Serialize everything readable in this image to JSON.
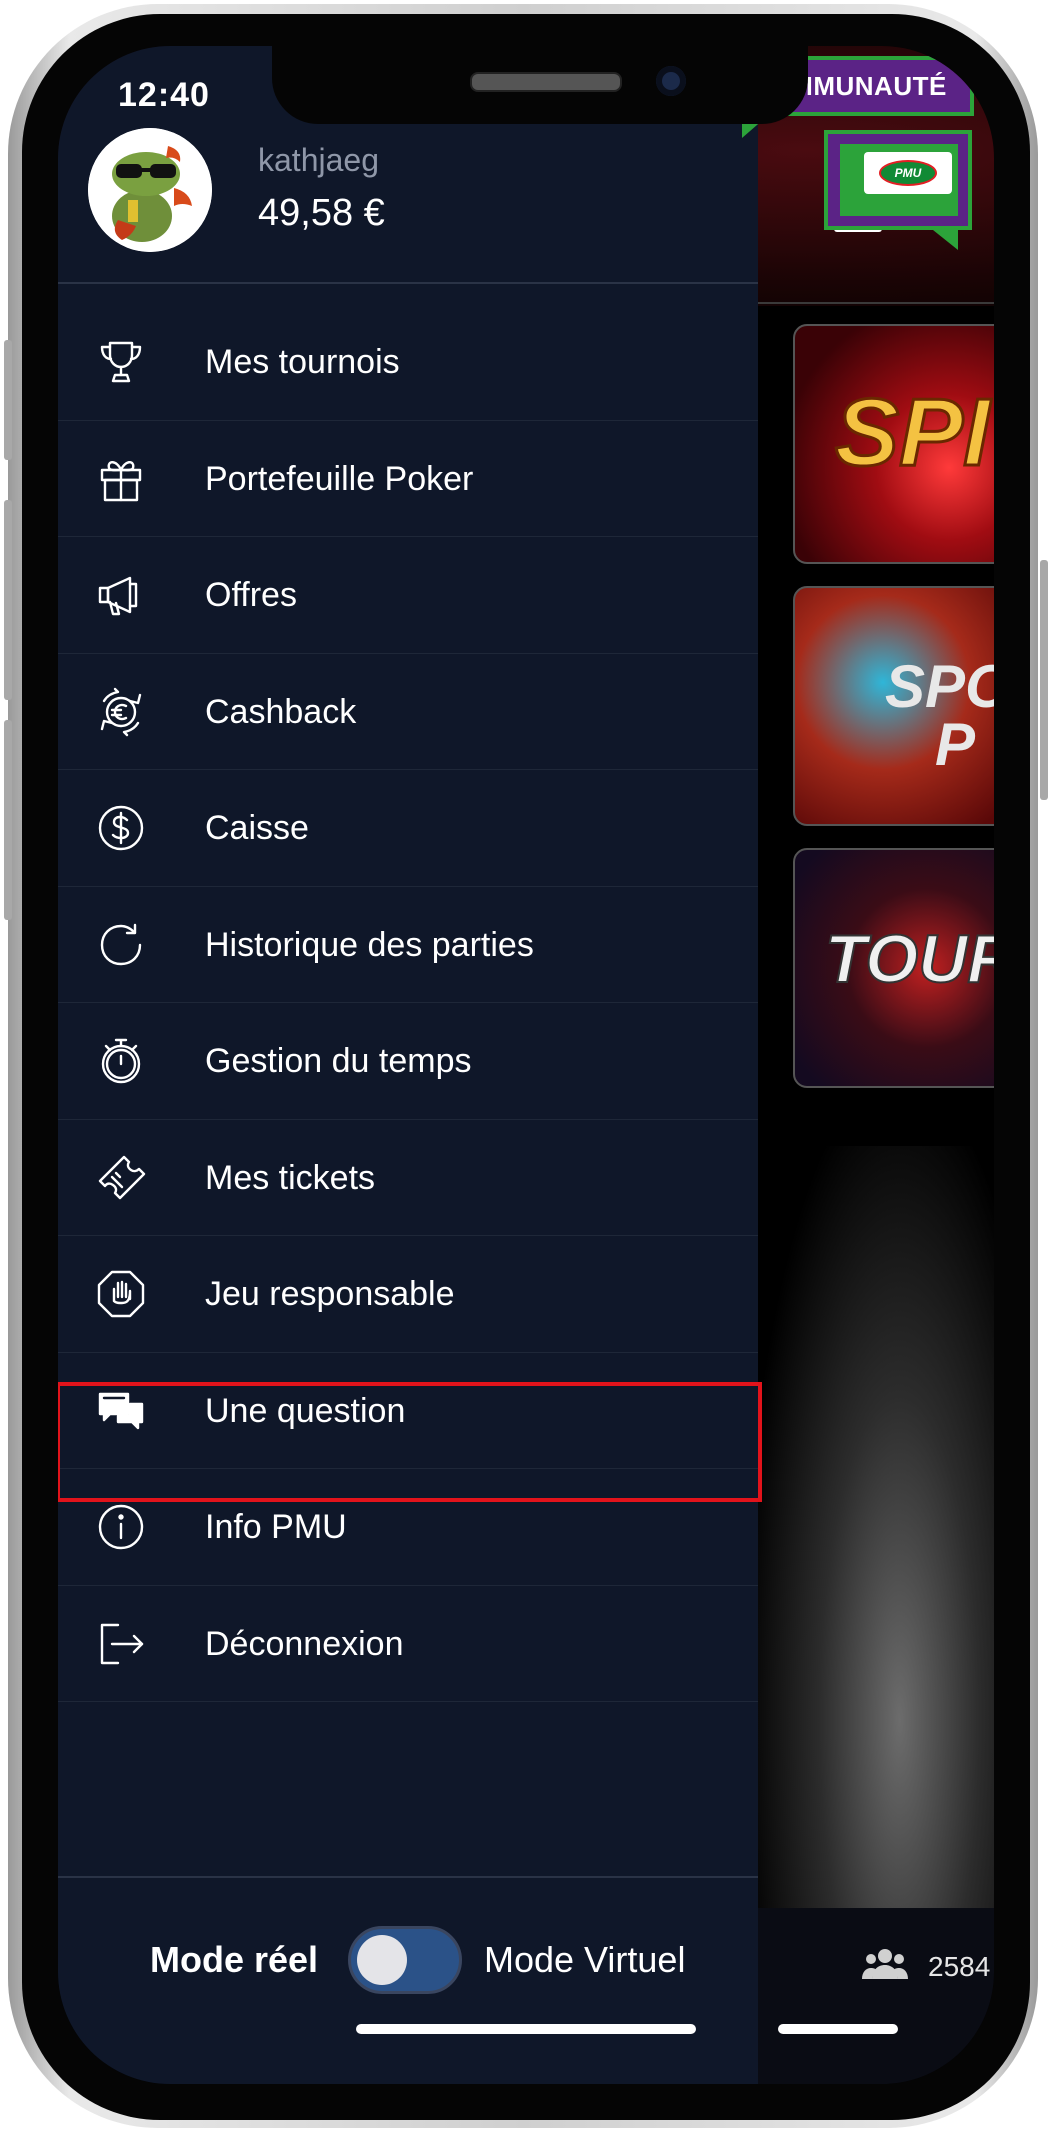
{
  "status_bar": {
    "time": "12:40"
  },
  "badge": {
    "label": "COMMUNAUTÉ",
    "logo_text": "PMU"
  },
  "profile": {
    "username": "kathjaeg",
    "balance": "49,58 €",
    "avatar_icon": "frog-avatar"
  },
  "menu": {
    "items": [
      {
        "label": "Mes tournois",
        "icon": "trophy-icon"
      },
      {
        "label": "Portefeuille Poker",
        "icon": "gift-icon"
      },
      {
        "label": "Offres",
        "icon": "megaphone-icon"
      },
      {
        "label": "Cashback",
        "icon": "euro-cycle-icon"
      },
      {
        "label": "Caisse",
        "icon": "dollar-circle-icon"
      },
      {
        "label": "Historique des parties",
        "icon": "history-icon"
      },
      {
        "label": "Gestion du temps",
        "icon": "stopwatch-icon"
      },
      {
        "label": "Mes tickets",
        "icon": "ticket-icon"
      },
      {
        "label": "Jeu responsable",
        "icon": "hand-stop-icon"
      },
      {
        "label": "Une question",
        "icon": "chat-icon"
      },
      {
        "label": "Info PMU",
        "icon": "info-icon"
      },
      {
        "label": "Déconnexion",
        "icon": "logout-icon"
      }
    ]
  },
  "mode": {
    "real_label": "Mode réel",
    "virtual_label": "Mode Virtuel"
  },
  "background_app": {
    "tiles": [
      "SPI",
      "SPO\n   P",
      "TOUR"
    ],
    "online_count": "2584"
  },
  "colors": {
    "drawer_bg": "#0f1729",
    "highlight": "#e2131b",
    "badge_purple": "#5b2386",
    "badge_green": "#2ca33a",
    "toggle_track": "#2b5288"
  }
}
